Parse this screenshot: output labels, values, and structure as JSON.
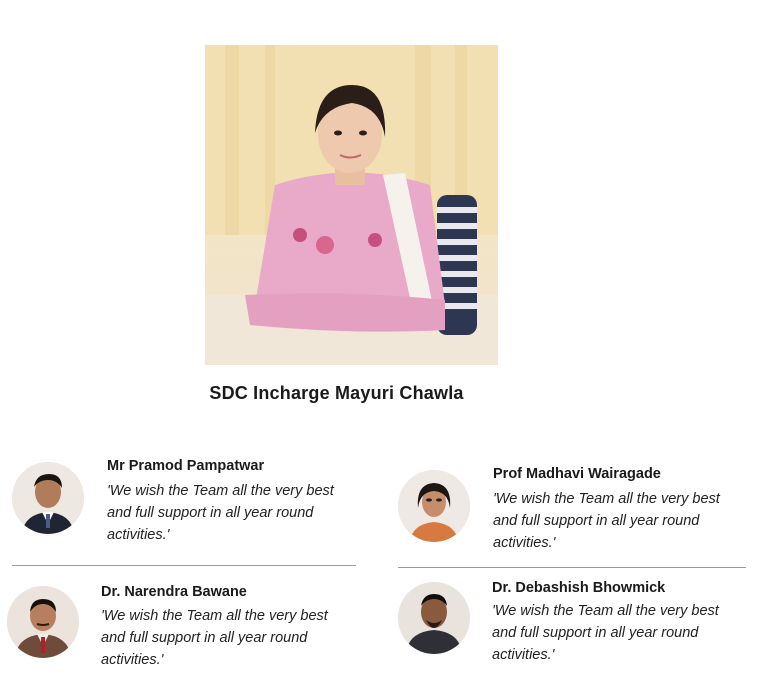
{
  "hero": {
    "caption": "SDC Incharge Mayuri Chawla",
    "photo_icon": "person-photo-icon"
  },
  "members": [
    {
      "name": "Mr Pramod Pampatwar",
      "quote": "'We wish the Team all the very best and full support in all year round activities.'",
      "avatar_icon": "person-avatar-icon"
    },
    {
      "name": "Prof Madhavi Wairagade",
      "quote": "'We wish the Team all the very best and full support in all year round activities.'",
      "avatar_icon": "person-avatar-icon"
    },
    {
      "name": "Dr. Narendra Bawane",
      "quote": "'We wish the Team all the very best and full support in all year round activities.'",
      "avatar_icon": "person-avatar-icon"
    },
    {
      "name": "Dr. Debashish Bhowmick",
      "quote": "'We wish the Team all the very best and full support in all year round activities.'",
      "avatar_icon": "person-avatar-icon"
    }
  ]
}
